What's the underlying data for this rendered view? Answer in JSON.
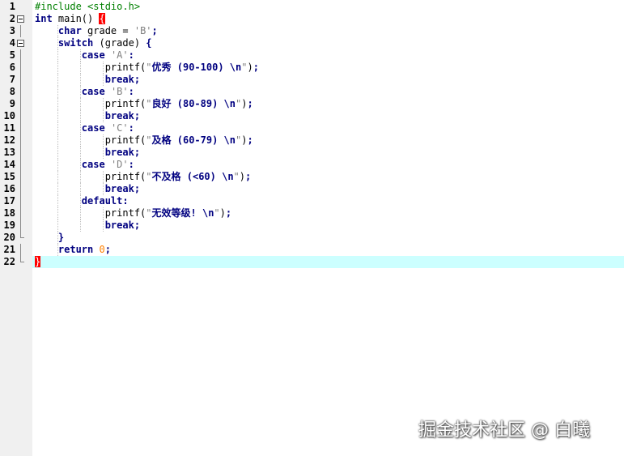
{
  "editor": {
    "lines": [
      {
        "num": "1",
        "fold": "none",
        "guides": 0,
        "tokens": [
          {
            "c": "pp",
            "t": "#include <stdio.h>"
          }
        ]
      },
      {
        "num": "2",
        "fold": "open",
        "guides": 0,
        "tokens": [
          {
            "c": "kw",
            "t": "int"
          },
          {
            "c": "",
            "t": " main() "
          },
          {
            "c": "brace-hl",
            "t": "{"
          }
        ]
      },
      {
        "num": "3",
        "fold": "line",
        "guides": 1,
        "tokens": [
          {
            "c": "",
            "t": "    "
          },
          {
            "c": "kw",
            "t": "char"
          },
          {
            "c": "",
            "t": " grade = "
          },
          {
            "c": "str",
            "t": "'B'"
          },
          {
            "c": "op",
            "t": ";"
          }
        ]
      },
      {
        "num": "4",
        "fold": "open",
        "guides": 1,
        "tokens": [
          {
            "c": "",
            "t": "    "
          },
          {
            "c": "kw",
            "t": "switch"
          },
          {
            "c": "",
            "t": " (grade) "
          },
          {
            "c": "op",
            "t": "{"
          }
        ]
      },
      {
        "num": "5",
        "fold": "line",
        "guides": 2,
        "tokens": [
          {
            "c": "",
            "t": "        "
          },
          {
            "c": "kw",
            "t": "case"
          },
          {
            "c": "",
            "t": " "
          },
          {
            "c": "str",
            "t": "'A'"
          },
          {
            "c": "op",
            "t": ":"
          }
        ]
      },
      {
        "num": "6",
        "fold": "line",
        "guides": 3,
        "tokens": [
          {
            "c": "",
            "t": "            printf("
          },
          {
            "c": "str",
            "t": "\""
          },
          {
            "c": "zh",
            "t": "优秀 (90-100) \\n"
          },
          {
            "c": "str",
            "t": "\""
          },
          {
            "c": "",
            "t": ")"
          },
          {
            "c": "op",
            "t": ";"
          }
        ]
      },
      {
        "num": "7",
        "fold": "line",
        "guides": 3,
        "tokens": [
          {
            "c": "",
            "t": "            "
          },
          {
            "c": "kw",
            "t": "break"
          },
          {
            "c": "op",
            "t": ";"
          }
        ]
      },
      {
        "num": "8",
        "fold": "line",
        "guides": 2,
        "tokens": [
          {
            "c": "",
            "t": "        "
          },
          {
            "c": "kw",
            "t": "case"
          },
          {
            "c": "",
            "t": " "
          },
          {
            "c": "str",
            "t": "'B'"
          },
          {
            "c": "op",
            "t": ":"
          }
        ]
      },
      {
        "num": "9",
        "fold": "line",
        "guides": 3,
        "tokens": [
          {
            "c": "",
            "t": "            printf("
          },
          {
            "c": "str",
            "t": "\""
          },
          {
            "c": "zh",
            "t": "良好 (80-89) \\n"
          },
          {
            "c": "str",
            "t": "\""
          },
          {
            "c": "",
            "t": ")"
          },
          {
            "c": "op",
            "t": ";"
          }
        ]
      },
      {
        "num": "10",
        "fold": "line",
        "guides": 3,
        "tokens": [
          {
            "c": "",
            "t": "            "
          },
          {
            "c": "kw",
            "t": "break"
          },
          {
            "c": "op",
            "t": ";"
          }
        ]
      },
      {
        "num": "11",
        "fold": "line",
        "guides": 2,
        "tokens": [
          {
            "c": "",
            "t": "        "
          },
          {
            "c": "kw",
            "t": "case"
          },
          {
            "c": "",
            "t": " "
          },
          {
            "c": "str",
            "t": "'C'"
          },
          {
            "c": "op",
            "t": ":"
          }
        ]
      },
      {
        "num": "12",
        "fold": "line",
        "guides": 3,
        "tokens": [
          {
            "c": "",
            "t": "            printf("
          },
          {
            "c": "str",
            "t": "\""
          },
          {
            "c": "zh",
            "t": "及格 (60-79) \\n"
          },
          {
            "c": "str",
            "t": "\""
          },
          {
            "c": "",
            "t": ")"
          },
          {
            "c": "op",
            "t": ";"
          }
        ]
      },
      {
        "num": "13",
        "fold": "line",
        "guides": 3,
        "tokens": [
          {
            "c": "",
            "t": "            "
          },
          {
            "c": "kw",
            "t": "break"
          },
          {
            "c": "op",
            "t": ";"
          }
        ]
      },
      {
        "num": "14",
        "fold": "line",
        "guides": 2,
        "tokens": [
          {
            "c": "",
            "t": "        "
          },
          {
            "c": "kw",
            "t": "case"
          },
          {
            "c": "",
            "t": " "
          },
          {
            "c": "str",
            "t": "'D'"
          },
          {
            "c": "op",
            "t": ":"
          }
        ]
      },
      {
        "num": "15",
        "fold": "line",
        "guides": 3,
        "tokens": [
          {
            "c": "",
            "t": "            printf("
          },
          {
            "c": "str",
            "t": "\""
          },
          {
            "c": "zh",
            "t": "不及格 (<60) \\n"
          },
          {
            "c": "str",
            "t": "\""
          },
          {
            "c": "",
            "t": ")"
          },
          {
            "c": "op",
            "t": ";"
          }
        ]
      },
      {
        "num": "16",
        "fold": "line",
        "guides": 3,
        "tokens": [
          {
            "c": "",
            "t": "            "
          },
          {
            "c": "kw",
            "t": "break"
          },
          {
            "c": "op",
            "t": ";"
          }
        ]
      },
      {
        "num": "17",
        "fold": "line",
        "guides": 2,
        "tokens": [
          {
            "c": "",
            "t": "        "
          },
          {
            "c": "kw",
            "t": "default"
          },
          {
            "c": "op",
            "t": ":"
          }
        ]
      },
      {
        "num": "18",
        "fold": "line",
        "guides": 3,
        "tokens": [
          {
            "c": "",
            "t": "            printf("
          },
          {
            "c": "str",
            "t": "\""
          },
          {
            "c": "zh",
            "t": "无效等级! \\n"
          },
          {
            "c": "str",
            "t": "\""
          },
          {
            "c": "",
            "t": ")"
          },
          {
            "c": "op",
            "t": ";"
          }
        ]
      },
      {
        "num": "19",
        "fold": "line",
        "guides": 3,
        "tokens": [
          {
            "c": "",
            "t": "            "
          },
          {
            "c": "kw",
            "t": "break"
          },
          {
            "c": "op",
            "t": ";"
          }
        ]
      },
      {
        "num": "20",
        "fold": "end",
        "guides": 1,
        "tokens": [
          {
            "c": "",
            "t": "    "
          },
          {
            "c": "op",
            "t": "}"
          }
        ]
      },
      {
        "num": "21",
        "fold": "line",
        "guides": 1,
        "tokens": [
          {
            "c": "",
            "t": "    "
          },
          {
            "c": "kw",
            "t": "return"
          },
          {
            "c": "",
            "t": " "
          },
          {
            "c": "num",
            "t": "0"
          },
          {
            "c": "op",
            "t": ";"
          }
        ]
      },
      {
        "num": "22",
        "fold": "end",
        "guides": 0,
        "current": true,
        "tokens": [
          {
            "c": "brace-hl",
            "t": "}"
          }
        ]
      }
    ]
  },
  "watermark": "掘金技术社区 @ 白曦",
  "colors": {
    "gutter": "#f0f0f0",
    "current_line": "#ccffff",
    "keyword": "#000080",
    "preprocessor": "#008000",
    "string": "#808080",
    "number": "#ff8000",
    "brace_match": "#ff0000"
  }
}
